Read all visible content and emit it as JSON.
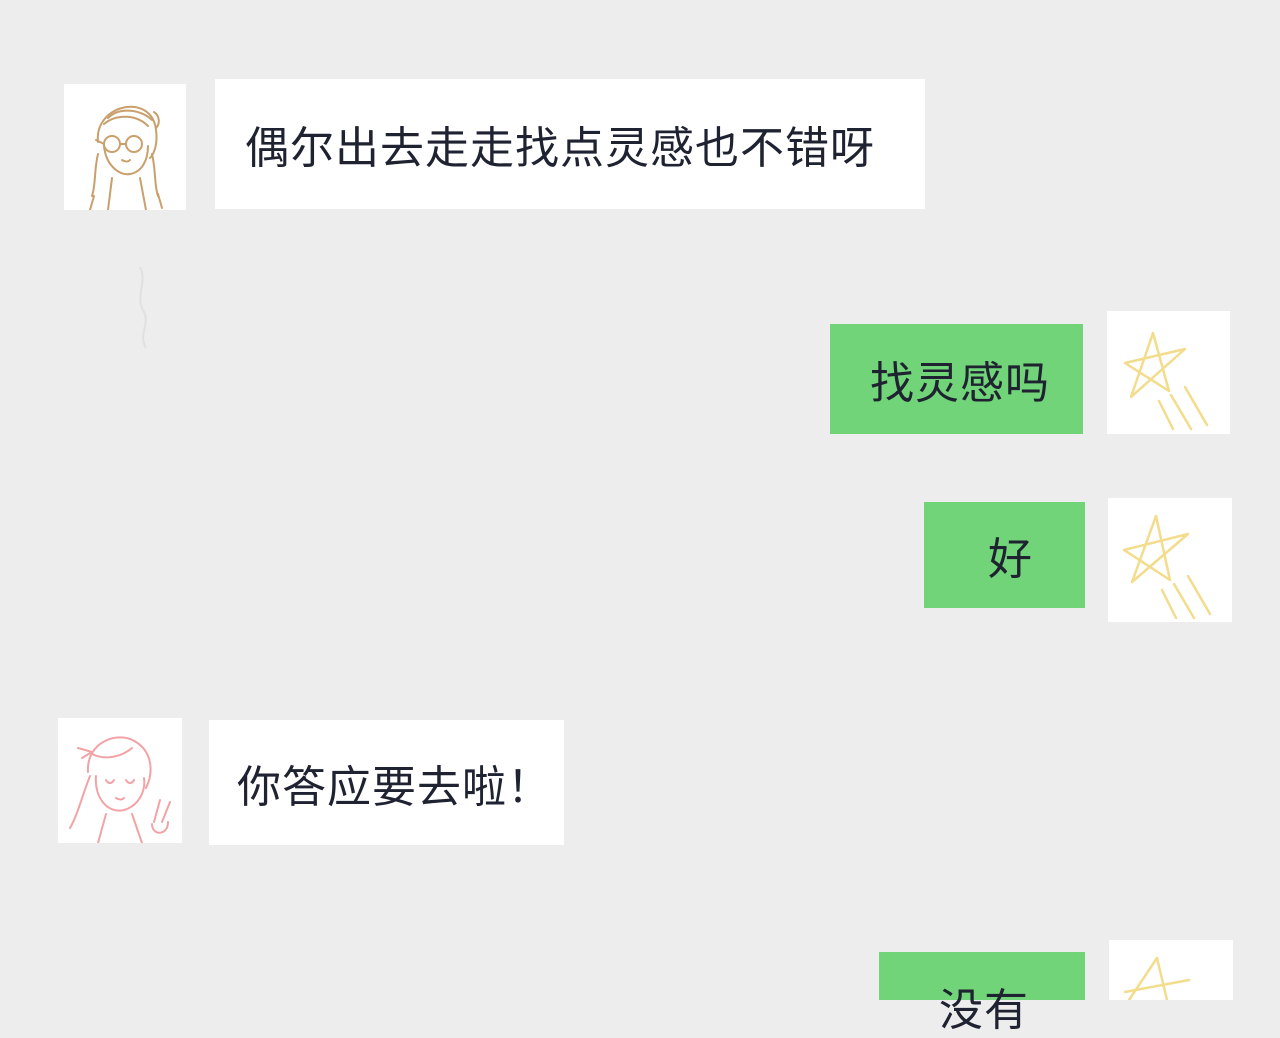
{
  "messages": [
    {
      "side": "left",
      "avatar": "glasses-girl-avatar",
      "text": "偶尔出去走走找点灵感也不错呀"
    },
    {
      "side": "right",
      "avatar": "star-doodle-avatar",
      "text": "找灵感吗"
    },
    {
      "side": "right",
      "avatar": "star-doodle-avatar",
      "text": "好"
    },
    {
      "side": "left",
      "avatar": "peace-sign-girl-avatar",
      "text": "你答应要去啦！"
    },
    {
      "side": "right",
      "avatar": "star-doodle-avatar",
      "text": "没有"
    }
  ],
  "colors": {
    "background": "#ededed",
    "incoming_bubble": "#ffffff",
    "outgoing_bubble": "#71d479",
    "text": "#1f2230"
  }
}
